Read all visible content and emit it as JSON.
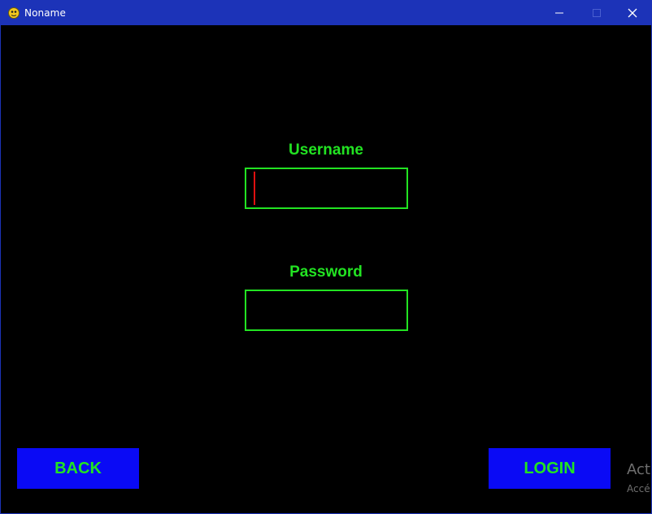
{
  "window": {
    "title": "Noname",
    "icon": "pygame-snake-icon",
    "controls": {
      "minimize_icon": "minimize-icon",
      "maximize_icon": "maximize-icon",
      "close_icon": "close-icon"
    }
  },
  "form": {
    "username_label": "Username",
    "username_value": "",
    "password_label": "Password",
    "password_value": ""
  },
  "buttons": {
    "back_label": "BACK",
    "login_label": "LOGIN"
  },
  "watermark": {
    "line1": "Act",
    "line2": "Accé"
  },
  "colors": {
    "titlebar": "#1c33b8",
    "background": "#000000",
    "text_green": "#22e322",
    "button_blue": "#0a0af5",
    "caret_red": "#e01010"
  }
}
